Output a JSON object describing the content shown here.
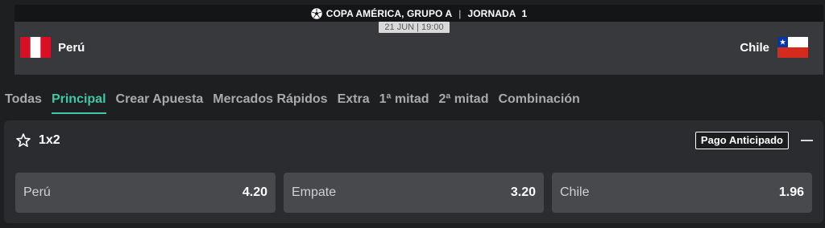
{
  "header": {
    "competition": "COPA AMÉRICA, GRUPO A",
    "separator": "|",
    "round_label": "JORNADA",
    "round_number": "1",
    "datetime": "21 JUN | 19:00"
  },
  "teams": {
    "home": {
      "name": "Perú",
      "flag": "peru-flag"
    },
    "away": {
      "name": "Chile",
      "flag": "chile-flag"
    }
  },
  "tabs": [
    {
      "label": "Todas",
      "active": false
    },
    {
      "label": "Principal",
      "active": true
    },
    {
      "label": "Crear Apuesta",
      "active": false
    },
    {
      "label": "Mercados Rápidos",
      "active": false
    },
    {
      "label": "Extra",
      "active": false
    },
    {
      "label": "1ª mitad",
      "active": false
    },
    {
      "label": "2ª mitad",
      "active": false
    },
    {
      "label": "Combinación",
      "active": false
    }
  ],
  "market": {
    "title": "1x2",
    "badge": "Pago Anticipado",
    "outcomes": [
      {
        "label": "Perú",
        "odds": "4.20"
      },
      {
        "label": "Empate",
        "odds": "3.20"
      },
      {
        "label": "Chile",
        "odds": "1.96"
      }
    ]
  },
  "colors": {
    "accent": "#40c8a6",
    "background": "#1e1f21",
    "panel": "#2b2c2f",
    "outcome_button": "#48494c"
  }
}
